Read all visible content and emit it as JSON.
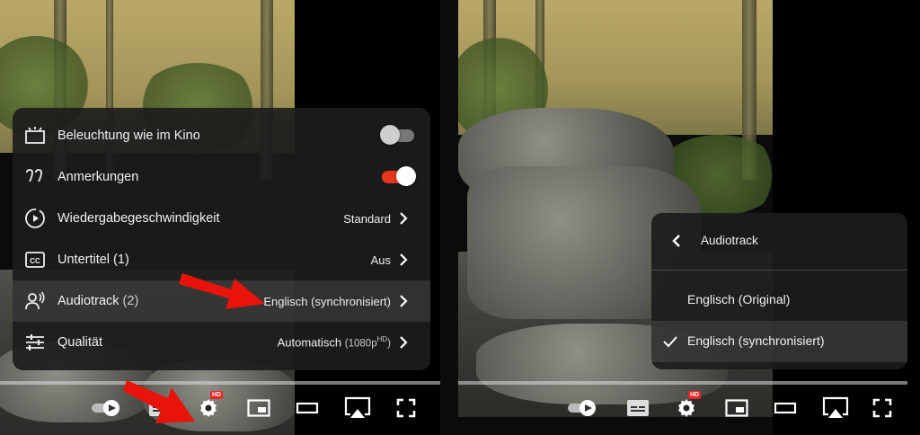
{
  "settings_menu": {
    "items": [
      {
        "label": "Beleuchtung wie im Kino",
        "type": "toggle",
        "on": false,
        "icon": "ambient-mode-icon"
      },
      {
        "label": "Anmerkungen",
        "type": "toggle",
        "on": true,
        "icon": "annotations-icon"
      },
      {
        "label": "Wiedergabegeschwindigkeit",
        "type": "submenu",
        "value": "Standard",
        "icon": "playback-speed-icon"
      },
      {
        "label": "Untertitel (1)",
        "type": "submenu",
        "value": "Aus",
        "icon": "subtitles-icon"
      },
      {
        "label": "Audiotrack",
        "count": "(2)",
        "type": "submenu",
        "value": "Englisch (synchronisiert)",
        "icon": "audio-track-icon",
        "highlighted": true
      },
      {
        "label": "Qualität",
        "type": "submenu",
        "value": "Automatisch",
        "value_detail": "(1080p",
        "value_sup": "HD",
        "value_tail": ")",
        "icon": "quality-icon"
      }
    ]
  },
  "audio_menu": {
    "title": "Audiotrack",
    "options": [
      {
        "label": "Englisch (Original)",
        "selected": false
      },
      {
        "label": "Englisch (synchronisiert)",
        "selected": true
      }
    ]
  },
  "controls": {
    "settings_badge": "HD"
  },
  "colors": {
    "toggle_on": "#e8341c",
    "annotation_arrow": "#e8140c",
    "menu_bg": "#1c1c1c"
  }
}
